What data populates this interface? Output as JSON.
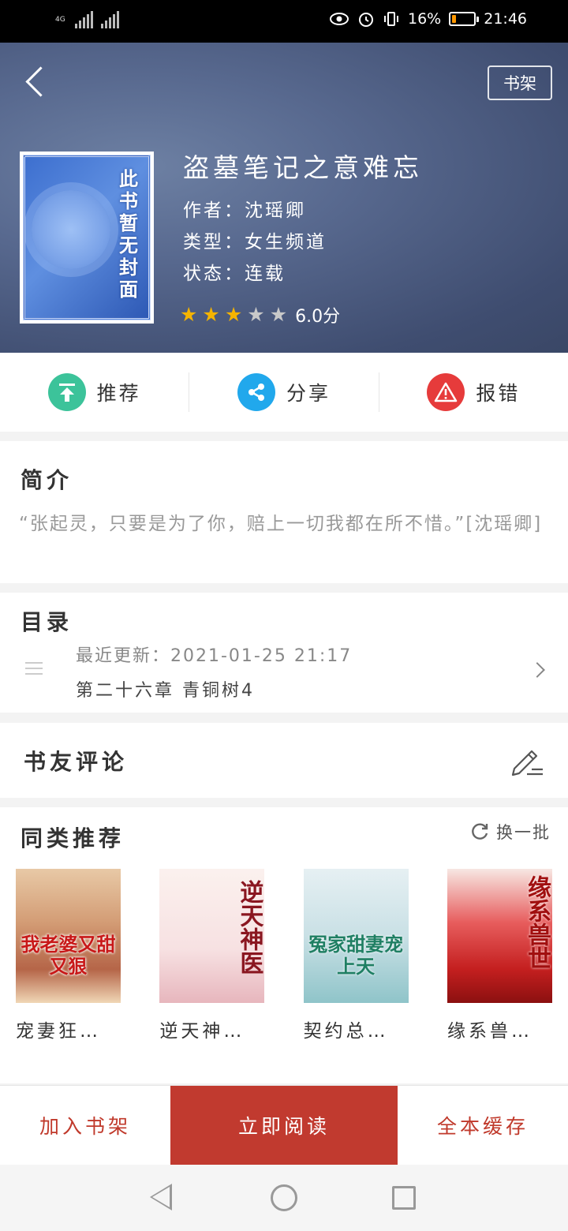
{
  "status_bar": {
    "network": "4G",
    "battery": "16%",
    "battery_level": 0.16,
    "time": "21:46"
  },
  "header": {
    "shelf_button": "书架",
    "cover_text": "此书暂无封面",
    "title": "盗墓笔记之意难忘",
    "author": "作者：沈瑶卿",
    "type": "类型：女生频道",
    "state": "状态：连载",
    "rating": {
      "stars_on": 3,
      "stars_total": 5,
      "score": "6.0分"
    }
  },
  "actions": {
    "recommend": "推荐",
    "share": "分享",
    "report": "报错"
  },
  "intro": {
    "title": "简介",
    "text": "“张起灵，只要是为了你，赔上一切我都在所不惜。”[沈瑶卿]"
  },
  "catalog": {
    "title": "目录",
    "update_label": "最近更新：2021-01-25 21:17",
    "latest_chapter": "第二十六章 青铜树4"
  },
  "comments": {
    "title": "书友评论"
  },
  "similar": {
    "title": "同类推荐",
    "refresh_label": "换一批",
    "books": [
      {
        "name": "宠妻狂…",
        "cover_text": "我老婆又甜又狠",
        "accent": "#c81818"
      },
      {
        "name": "逆天神…",
        "cover_text": "逆天神医",
        "accent": "#8a1620"
      },
      {
        "name": "契约总…",
        "cover_text": "冤家甜妻宠上天",
        "accent": "#1f7f63"
      },
      {
        "name": "缘系兽…",
        "cover_text": "缘系兽世",
        "accent": "#a10f0f"
      }
    ]
  },
  "bottom_bar": {
    "add_shelf": "加入书架",
    "read_now": "立即阅读",
    "cache_all": "全本缓存",
    "accent": "#c13a2f"
  }
}
